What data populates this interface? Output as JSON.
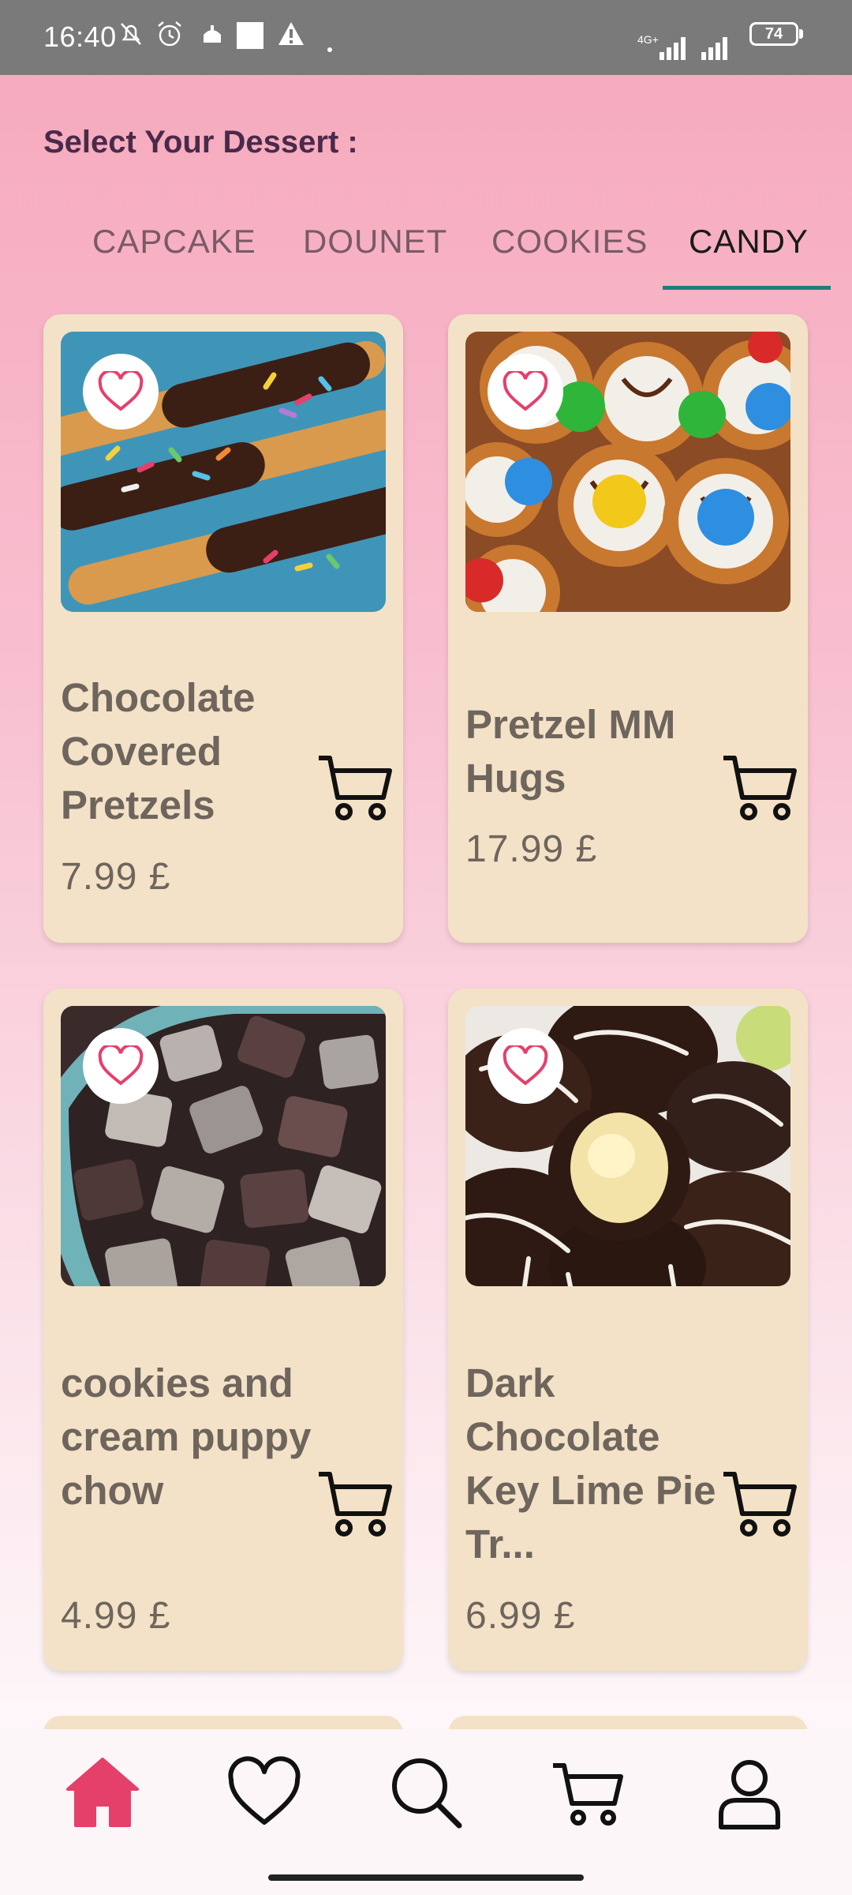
{
  "status_bar": {
    "time": "16:40",
    "network": "4G+",
    "battery": "74"
  },
  "page": {
    "heading": "Select Your Dessert :"
  },
  "tabs": [
    {
      "label": "CAPCAKE",
      "active": false
    },
    {
      "label": "DOUNET",
      "active": false
    },
    {
      "label": "COOKIES",
      "active": false
    },
    {
      "label": "CANDY",
      "active": true
    }
  ],
  "products": [
    {
      "name": "Chocolate Covered Pretzels",
      "price": "7.99  £",
      "image": "chocolate-pretzels-photo",
      "favorite_icon": "heart-outline-icon"
    },
    {
      "name": "Pretzel MM Hugs",
      "price": "17.99  £",
      "image": "pretzel-mm-hugs-photo",
      "favorite_icon": "heart-outline-icon"
    },
    {
      "name": "cookies and cream puppy chow",
      "price": "4.99  £",
      "image": "puppy-chow-photo",
      "favorite_icon": "heart-outline-icon"
    },
    {
      "name": "Dark Chocolate Key Lime Pie Tr...",
      "price": "6.99  £",
      "image": "key-lime-truffles-photo",
      "favorite_icon": "heart-outline-icon"
    }
  ],
  "bottom_nav": [
    {
      "name": "home",
      "icon": "home-icon",
      "active": true
    },
    {
      "name": "favorites",
      "icon": "heart-icon",
      "active": false
    },
    {
      "name": "search",
      "icon": "search-icon",
      "active": false
    },
    {
      "name": "cart",
      "icon": "cart-icon",
      "active": false
    },
    {
      "name": "profile",
      "icon": "user-icon",
      "active": false
    }
  ],
  "colors": {
    "accent": "#e5406a",
    "tab_indicator": "#1e7f7a",
    "card_bg": "#f3e2c7",
    "text_muted": "#6e655d"
  }
}
